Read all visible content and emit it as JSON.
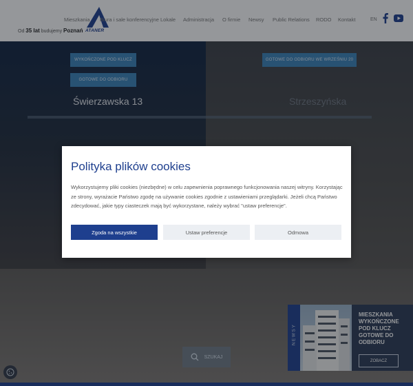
{
  "header": {
    "tagline_prefix": "Od",
    "tagline_years": "35 lat",
    "tagline_mid": "budujemy",
    "tagline_city": "Poznań",
    "logo_text": "ATANER",
    "nav": [
      "Mieszkania",
      "Biura i sale konferencyjne",
      "Lokale",
      "Administracja",
      "O firmie",
      "Newsy",
      "Public Relations",
      "RODO",
      "Kontakt"
    ],
    "lang": "EN"
  },
  "hero": {
    "left_tags": [
      "WYKOŃCZONE POD KLUCZ",
      "GOTOWE DO ODBIORU"
    ],
    "left_address": "Świerzawska 13",
    "right_tag": "GOTOWE DO ODBIORU WE WRZEŚNIU 20",
    "right_address": "Strzeszyńska",
    "search_label": "SZUKAJ"
  },
  "news": {
    "tab_label": "NEWSY",
    "title": "MIESZKANIA WYKOŃCZONE POD KLUCZ GOTOWE DO ODBIORU",
    "button_label": "ZOBACZ"
  },
  "cookie_modal": {
    "title": "Polityka plików cookies",
    "text": "Wykorzystujemy pliki cookies (niezbędne) w celu zapewnienia poprawnego funkcjonowania naszej witryny. Korzystając ze strony, wyrażacie Państwo zgodę na używanie cookies zgodnie z ustawieniami przeglądarki. Jeżeli chcą Państwo zdecydować, jakie typy ciasteczek mają być wykorzystane, należy wybrać \"ustaw preferencje\".",
    "accept_label": "Zgoda na wszystkie",
    "preferences_label": "Ustaw preferencje",
    "reject_label": "Odmowa"
  },
  "colors": {
    "brand": "#1e3f8e",
    "tag": "#3a82b8"
  }
}
